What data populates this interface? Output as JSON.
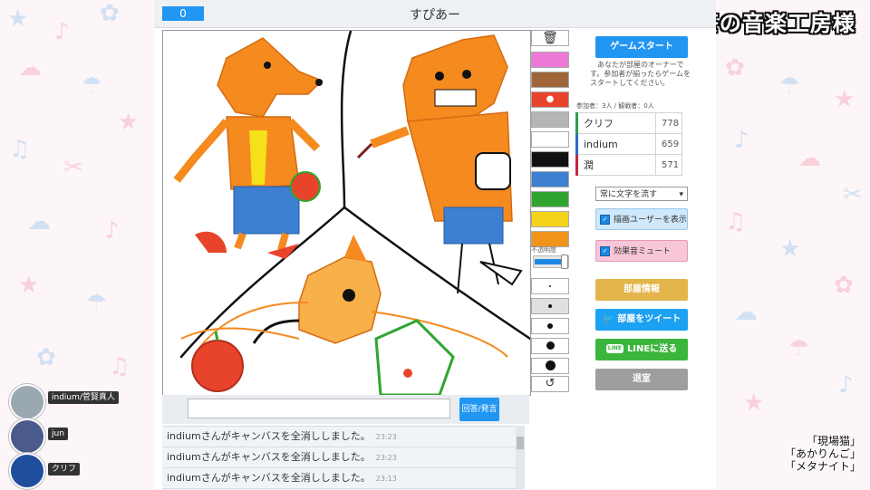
{
  "stream": {
    "bgm_credit": "BGM：甘茶の音楽工房様",
    "songs": [
      "「現場猫」",
      "「あかりんご」",
      "「メタナイト」"
    ]
  },
  "viewers": [
    {
      "name": "indium/菅賢真人",
      "avatar_color": "#9aa8b2"
    },
    {
      "name": "jun",
      "avatar_color": "#4a5a8a"
    },
    {
      "name": "クリフ",
      "avatar_color": "#1f4e9c"
    }
  ],
  "header": {
    "score": "0",
    "room_title": "すぴあー"
  },
  "tools": {
    "palette": [
      "#ee7ad8",
      "#a0663a",
      "#e8442c",
      "#b5b5b5",
      "#ffffff",
      "#111111",
      "#3d7fd1",
      "#2fa52f",
      "#f5d31a",
      "#f0941c"
    ],
    "selected_color_index": 2,
    "opacity_label": "不透明度",
    "opacity_value": 0.9,
    "pen_sizes": [
      1,
      3,
      5,
      8,
      10,
      12
    ]
  },
  "answer": {
    "button_label": "回答/発言"
  },
  "log": [
    {
      "text": "indiumさんがキャンバスを全消ししました。",
      "time": "23:23"
    },
    {
      "text": "indiumさんがキャンバスを全消ししました。",
      "time": "23:23"
    },
    {
      "text": "indiumさんがキャンバスを全消ししました。",
      "time": "23:13"
    }
  ],
  "panel": {
    "start_button": "ゲームスタート",
    "owner_message": "あなたが部屋のオーナーです。参加者が揃ったらゲームをスタートしてください。",
    "participant_counts": "参加者：3人 / 観戦者：0人",
    "scores": [
      {
        "name": "クリフ",
        "score": "778",
        "color": "#2e9e4a"
      },
      {
        "name": "indium",
        "score": "659",
        "color": "#2a6cc8"
      },
      {
        "name": "潤",
        "score": "571",
        "color": "#c0283a"
      }
    ],
    "text_option": "常に文字を流す",
    "show_drawer_label": "描画ユーザーを表示",
    "mute_label": "効果音ミュート",
    "room_info": "部屋情報",
    "tweet": "部屋をツイート",
    "line_share": "LINEに送る",
    "exit": "退室"
  }
}
